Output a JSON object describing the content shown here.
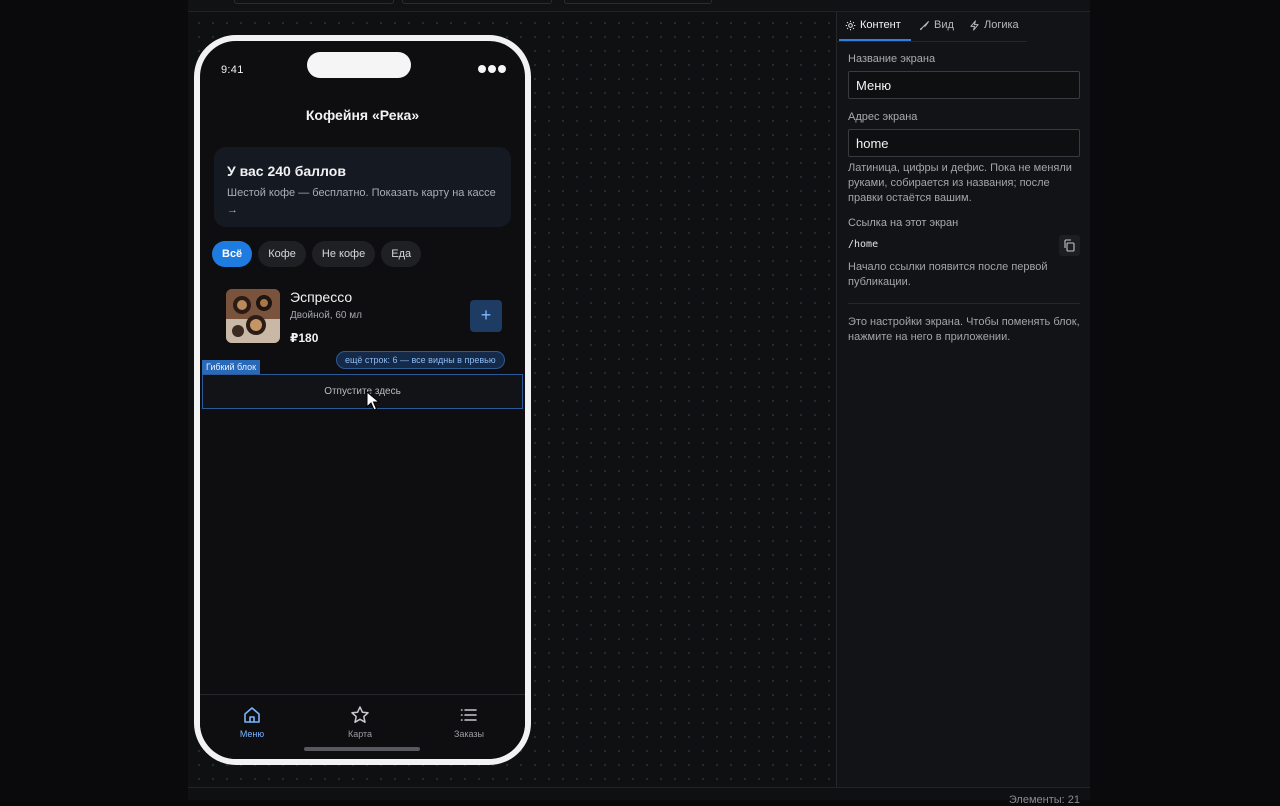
{
  "toolbar": {
    "count_label": "Элементы: 21"
  },
  "phone": {
    "time": "9:41",
    "title": "Кофейня «Река»",
    "loyalty": {
      "title": "У вас 240 баллов",
      "text": "Шестой кофе — бесплатно. Показать карту на кассе →"
    },
    "chips": [
      {
        "label": "Всё",
        "active": true
      },
      {
        "label": "Кофе",
        "active": false
      },
      {
        "label": "Не кофе",
        "active": false
      },
      {
        "label": "Еда",
        "active": false
      }
    ],
    "product": {
      "name": "Эспрессо",
      "description": "Двойной, 60 мл",
      "price": "₽180",
      "add_label": "+"
    },
    "more_rows": "ещё строк: 6 — все видны в превью",
    "flex_block_label": "Гибкий блок",
    "drop_hint": "Отпустите здесь",
    "tabs": [
      {
        "label": "Меню",
        "icon": "home-icon",
        "active": true
      },
      {
        "label": "Карта",
        "icon": "star-icon",
        "active": false
      },
      {
        "label": "Заказы",
        "icon": "list-icon",
        "active": false
      }
    ]
  },
  "panel": {
    "tabs": [
      {
        "label": "Контент",
        "icon": "gear-icon",
        "active": true
      },
      {
        "label": "Вид",
        "icon": "brush-icon",
        "active": false
      },
      {
        "label": "Логика",
        "icon": "bolt-icon",
        "active": false
      }
    ],
    "screen_name": {
      "label": "Название экрана",
      "value": "Меню"
    },
    "screen_address": {
      "label": "Адрес экрана",
      "value": "home"
    },
    "address_help": "Латиница, цифры и дефис. Пока не меняли руками, собирается из названия; после правки остаётся вашим.",
    "link": {
      "label": "Ссылка на этот экран",
      "value": "/home"
    },
    "link_help": "Начало ссылки появится после первой публикации.",
    "settings_note": "Это настройки экрана. Чтобы поменять блок, нажмите на него в приложении."
  },
  "colors": {
    "accent": "#1e7bdf",
    "selection": "#2a68b8"
  }
}
